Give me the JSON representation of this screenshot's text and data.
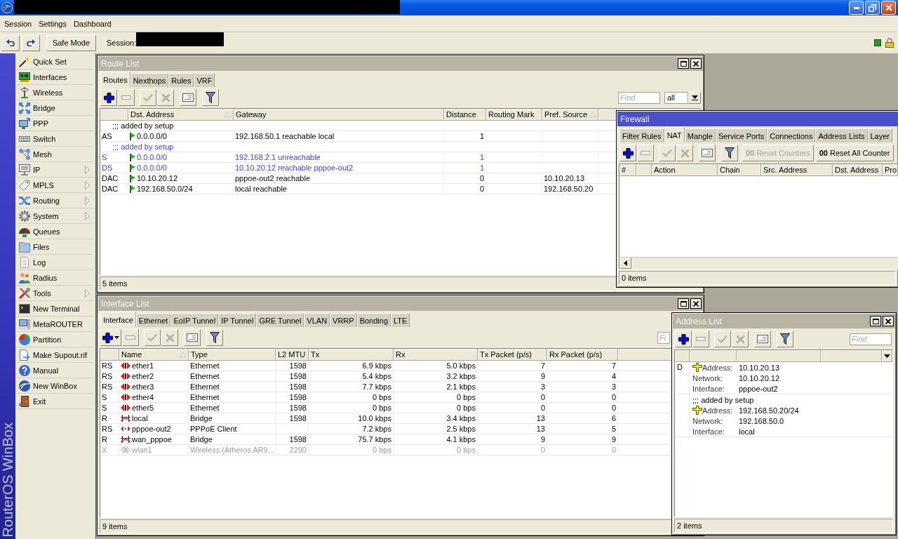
{
  "menu": [
    {
      "label": "Session"
    },
    {
      "label": "Settings"
    },
    {
      "label": "Dashboard"
    }
  ],
  "toolbar": {
    "safe_mode": "Safe Mode",
    "session_label": "Session:"
  },
  "banner": "RouterOS WinBox",
  "sidebar": [
    {
      "label": "Quick Set",
      "submenu": false
    },
    {
      "label": "Interfaces",
      "submenu": false
    },
    {
      "label": "Wireless",
      "submenu": false
    },
    {
      "label": "Bridge",
      "submenu": false
    },
    {
      "label": "PPP",
      "submenu": false
    },
    {
      "label": "Switch",
      "submenu": false
    },
    {
      "label": "Mesh",
      "submenu": false
    },
    {
      "label": "IP",
      "submenu": true
    },
    {
      "label": "MPLS",
      "submenu": true
    },
    {
      "label": "Routing",
      "submenu": true
    },
    {
      "label": "System",
      "submenu": true
    },
    {
      "label": "Queues",
      "submenu": false
    },
    {
      "label": "Files",
      "submenu": false
    },
    {
      "label": "Log",
      "submenu": false
    },
    {
      "label": "Radius",
      "submenu": false
    },
    {
      "label": "Tools",
      "submenu": true
    },
    {
      "label": "New Terminal",
      "submenu": false
    },
    {
      "label": "MetaROUTER",
      "submenu": false
    },
    {
      "label": "Partition",
      "submenu": false
    },
    {
      "label": "Make Supout.rif",
      "submenu": false
    },
    {
      "label": "Manual",
      "submenu": false
    },
    {
      "label": "New WinBox",
      "submenu": false
    },
    {
      "label": "Exit",
      "submenu": false
    }
  ],
  "route_list": {
    "title": "Route List",
    "active": false,
    "tabs": [
      {
        "label": "Routes",
        "selected": true
      },
      {
        "label": "Nexthops",
        "selected": false
      },
      {
        "label": "Rules",
        "selected": false
      },
      {
        "label": "VRF",
        "selected": false
      }
    ],
    "tools": [
      {
        "kind": "add",
        "disabled": false
      },
      {
        "kind": "remove",
        "disabled": true
      },
      {
        "kind": "enable",
        "disabled": true
      },
      {
        "kind": "disable",
        "disabled": true
      },
      {
        "kind": "comment",
        "disabled": false
      },
      {
        "kind": "filter",
        "disabled": false
      }
    ],
    "find": {
      "placeholder": "Find"
    },
    "scope": {
      "value": "all"
    },
    "columns": [
      {
        "kind": "blank",
        "sorted": false
      },
      {
        "kind": "label",
        "label": "Dst. Address",
        "sorted": true
      },
      {
        "kind": "label",
        "label": "Gateway",
        "sorted": false
      },
      {
        "kind": "label",
        "label": "Distance",
        "sorted": false
      },
      {
        "kind": "label",
        "label": "Routing Mark",
        "sorted": false
      },
      {
        "kind": "label",
        "label": "Pref. Source",
        "sorted": true
      }
    ],
    "rows": [
      {
        "kind": "comment",
        "inactive": false,
        "text": ";;; added by setup"
      },
      {
        "kind": "route",
        "inactive": false,
        "flags": "AS",
        "dst": "0.0.0.0/0",
        "gateway": "192.168.50.1 reachable local",
        "distance": "1"
      },
      {
        "kind": "comment",
        "inactive": true,
        "text": ";;; added by setup"
      },
      {
        "kind": "route",
        "inactive": true,
        "flags": "S",
        "dst": "0.0.0.0/0",
        "gateway": "192.168.2.1 unreachable",
        "distance": "1"
      },
      {
        "kind": "route",
        "inactive": true,
        "flags": "DS",
        "dst": "0.0.0.0/0",
        "gateway": "10.10.20.12 reachable pppoe-out2",
        "distance": "1"
      },
      {
        "kind": "route",
        "inactive": false,
        "flags": "DAC",
        "dst": "10.10.20.12",
        "gateway": "pppoe-out2 reachable",
        "distance": "0",
        "pref_source": "10.10.20.13"
      },
      {
        "kind": "route",
        "inactive": false,
        "flags": "DAC",
        "dst": "192.168.50.0/24",
        "gateway": "local reachable",
        "distance": "0",
        "pref_source": "192.168.50.20"
      }
    ],
    "status": "5 items"
  },
  "firewall": {
    "title": "Firewall",
    "active": true,
    "tabs": [
      {
        "label": "Filter Rules",
        "selected": false
      },
      {
        "label": "NAT",
        "selected": true
      },
      {
        "label": "Mangle",
        "selected": false
      },
      {
        "label": "Service Ports",
        "selected": false
      },
      {
        "label": "Connections",
        "selected": false
      },
      {
        "label": "Address Lists",
        "selected": false
      },
      {
        "label": "Layer",
        "selected": false
      }
    ],
    "tools": [
      {
        "kind": "add",
        "disabled": false
      },
      {
        "kind": "remove",
        "disabled": true
      },
      {
        "kind": "enable",
        "disabled": true
      },
      {
        "kind": "disable",
        "disabled": true
      },
      {
        "kind": "comment",
        "disabled": false
      },
      {
        "kind": "filter",
        "disabled": false
      }
    ],
    "actions": [
      {
        "glyph": "00",
        "label": "Reset Counters",
        "disabled": true
      },
      {
        "glyph": "00",
        "label": "Reset All Counter",
        "disabled": false
      }
    ],
    "columns": [
      {
        "kind": "label",
        "label": "#",
        "sorted": false
      },
      {
        "kind": "blank",
        "sorted": false
      },
      {
        "kind": "label",
        "label": "Action",
        "sorted": false
      },
      {
        "kind": "label",
        "label": "Chain",
        "sorted": false
      },
      {
        "kind": "label",
        "label": "Src. Address",
        "sorted": false
      },
      {
        "kind": "label",
        "label": "Dst. Address",
        "sorted": false
      },
      {
        "kind": "label",
        "label": "Pro",
        "sorted": false
      }
    ],
    "status": "0 items"
  },
  "interface_list": {
    "title": "Interface List",
    "active": false,
    "tabs": [
      {
        "label": "Interface",
        "selected": true
      },
      {
        "label": "Ethernet",
        "selected": false
      },
      {
        "label": "EoIP Tunnel",
        "selected": false
      },
      {
        "label": "IP Tunnel",
        "selected": false
      },
      {
        "label": "GRE Tunnel",
        "selected": false
      },
      {
        "label": "VLAN",
        "selected": false
      },
      {
        "label": "VRRP",
        "selected": false
      },
      {
        "label": "Bonding",
        "selected": false
      },
      {
        "label": "LTE",
        "selected": false
      }
    ],
    "tools": [
      {
        "kind": "add_menu",
        "disabled": false
      },
      {
        "kind": "remove",
        "disabled": true
      },
      {
        "kind": "enable",
        "disabled": true
      },
      {
        "kind": "disable",
        "disabled": true
      },
      {
        "kind": "comment",
        "disabled": false
      },
      {
        "kind": "filter",
        "disabled": false
      }
    ],
    "find": {
      "placeholder": "Fi"
    },
    "columns": [
      {
        "kind": "blank",
        "sorted": false
      },
      {
        "kind": "label",
        "label": "Name",
        "sorted": true
      },
      {
        "kind": "label",
        "label": "Type",
        "sorted": false
      },
      {
        "kind": "label",
        "label": "L2 MTU",
        "sorted": false
      },
      {
        "kind": "label",
        "label": "Tx",
        "sorted": false
      },
      {
        "kind": "label",
        "label": "Rx",
        "sorted": false
      },
      {
        "kind": "label",
        "label": "Tx Packet (p/s)",
        "sorted": false
      },
      {
        "kind": "label",
        "label": "Rx Packet (p/s)",
        "sorted": false
      }
    ],
    "rows": [
      {
        "kind": "ethernet",
        "disabled": false,
        "flags": "RS",
        "name": "ether1",
        "type": "Ethernet",
        "l2_mtu": "1598",
        "tx": "6.9 kbps",
        "rx": "5.0 kbps",
        "tx_pps": "7",
        "rx_pps": "7"
      },
      {
        "kind": "ethernet",
        "disabled": false,
        "flags": "RS",
        "name": "ether2",
        "type": "Ethernet",
        "l2_mtu": "1598",
        "tx": "5.4 kbps",
        "rx": "3.2 kbps",
        "tx_pps": "9",
        "rx_pps": "4"
      },
      {
        "kind": "ethernet",
        "disabled": false,
        "flags": "RS",
        "name": "ether3",
        "type": "Ethernet",
        "l2_mtu": "1598",
        "tx": "7.7 kbps",
        "rx": "2.1 kbps",
        "tx_pps": "3",
        "rx_pps": "3"
      },
      {
        "kind": "ethernet",
        "disabled": false,
        "flags": "S",
        "name": "ether4",
        "type": "Ethernet",
        "l2_mtu": "1598",
        "tx": "0 bps",
        "rx": "0 bps",
        "tx_pps": "0",
        "rx_pps": "0"
      },
      {
        "kind": "ethernet",
        "disabled": false,
        "flags": "S",
        "name": "ether5",
        "type": "Ethernet",
        "l2_mtu": "1598",
        "tx": "0 bps",
        "rx": "0 bps",
        "tx_pps": "0",
        "rx_pps": "0"
      },
      {
        "kind": "bridge",
        "disabled": false,
        "flags": "R",
        "name": "local",
        "type": "Bridge",
        "l2_mtu": "1598",
        "tx": "10.0 kbps",
        "rx": "3.4 kbps",
        "tx_pps": "13",
        "rx_pps": "6"
      },
      {
        "kind": "pppoe",
        "disabled": false,
        "flags": "RS",
        "name": "pppoe-out2",
        "type": "PPPoE Client",
        "tx": "7.2 kbps",
        "rx": "2.5 kbps",
        "tx_pps": "13",
        "rx_pps": "5"
      },
      {
        "kind": "bridge",
        "disabled": false,
        "flags": "R",
        "name": "wan_pppoe",
        "type": "Bridge",
        "l2_mtu": "1598",
        "tx": "75.7 kbps",
        "rx": "4.1 kbps",
        "tx_pps": "9",
        "rx_pps": "9"
      },
      {
        "kind": "wireless",
        "disabled": true,
        "flags": "X",
        "name": "wlan1",
        "type": "Wireless (Atheros AR9...",
        "l2_mtu": "2290",
        "tx": "0 bps",
        "rx": "0 bps",
        "tx_pps": "0",
        "rx_pps": "0"
      }
    ],
    "status": "9 items"
  },
  "address_list": {
    "title": "Address List",
    "active": false,
    "tools": [
      {
        "kind": "add",
        "disabled": false
      },
      {
        "kind": "remove",
        "disabled": true
      },
      {
        "kind": "enable",
        "disabled": true
      },
      {
        "kind": "disable",
        "disabled": true
      },
      {
        "kind": "comment",
        "disabled": false
      },
      {
        "kind": "filter",
        "disabled": false
      }
    ],
    "find": {
      "placeholder": "Find"
    },
    "rows": [
      {
        "flags": "D",
        "fields": [
          {
            "label": "Address:",
            "value": "10.10.20.13"
          },
          {
            "label": "Network:",
            "value": "10.10.20.12"
          },
          {
            "label": "Interface:",
            "value": "pppoe-out2"
          }
        ]
      },
      {
        "comment": ";;; added by setup",
        "fields": [
          {
            "label": "Address:",
            "value": "192.168.50.20/24"
          },
          {
            "label": "Network:",
            "value": "192.168.50.0"
          },
          {
            "label": "Interface:",
            "value": "local"
          }
        ]
      }
    ],
    "status": "2 items"
  }
}
